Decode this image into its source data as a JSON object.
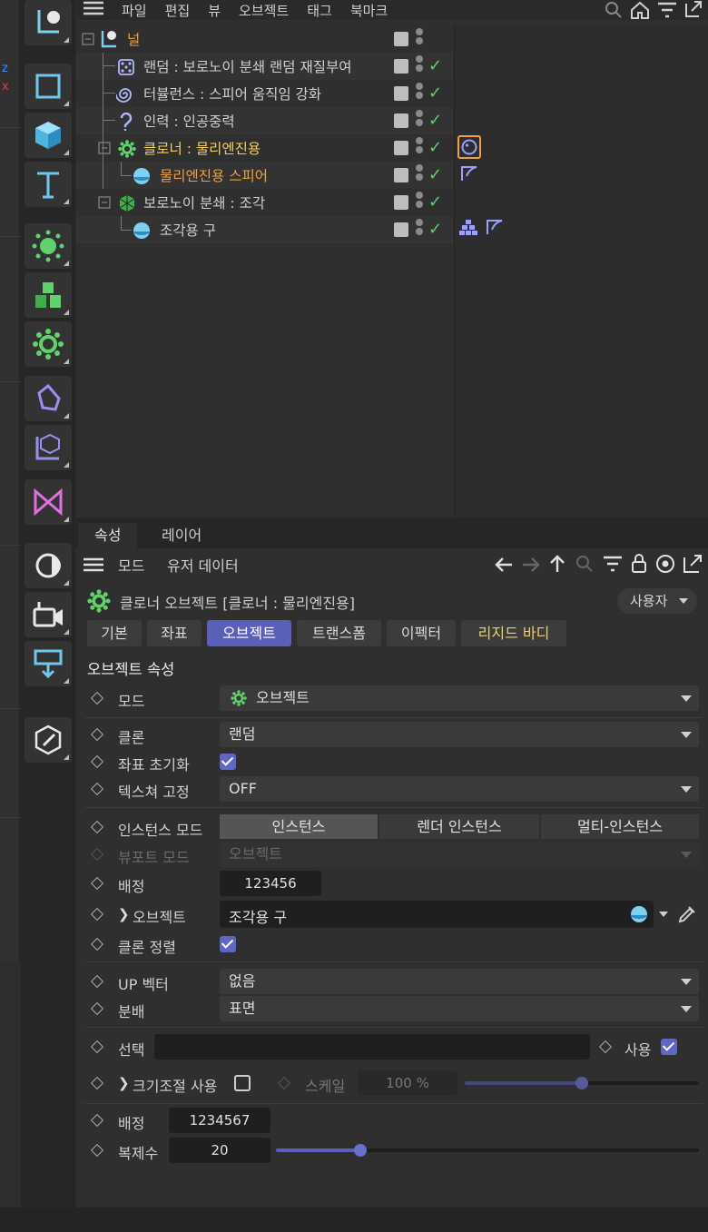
{
  "menu": {
    "items": [
      "파일",
      "편집",
      "뷰",
      "오브젝트",
      "태그",
      "북마크"
    ]
  },
  "objects": [
    {
      "name": "널",
      "color": "orange",
      "indent": 0
    },
    {
      "name": "랜덤 : 보로노이 분쇄 랜덤 재질부여",
      "color": "normal",
      "indent": 1
    },
    {
      "name": "터뷸런스 :  스피어 움직임 강화",
      "color": "normal",
      "indent": 1
    },
    {
      "name": "인력 : 인공중력",
      "color": "normal",
      "indent": 1
    },
    {
      "name": "클로너 : 물리엔진용",
      "color": "yellow",
      "indent": 1
    },
    {
      "name": "물리엔진용 스피어",
      "color": "orange",
      "indent": 2
    },
    {
      "name": "보로노이 분쇄 : 조각",
      "color": "normal",
      "indent": 1
    },
    {
      "name": "조각용 구",
      "color": "normal",
      "indent": 2
    }
  ],
  "attr": {
    "tabs": [
      "속성",
      "레이어"
    ],
    "toolbar": {
      "mode": "모드",
      "userdata": "유저 데이터"
    },
    "title": "클로너 오브젝트 [클로너 : 물리엔진용]",
    "user_button": "사용자",
    "subtabs": [
      "기본",
      "좌표",
      "오브젝트",
      "트랜스폼",
      "이펙터",
      "리지드 바디"
    ],
    "active_subtab": "오브젝트",
    "section_title": "오브젝트 속성",
    "mode": {
      "label": "모드",
      "value": "오브젝트"
    },
    "clone": {
      "label": "클론",
      "value": "랜덤"
    },
    "reset_coords": {
      "label": "좌표 초기화",
      "checked": true
    },
    "fix_texture": {
      "label": "텍스쳐 고정",
      "value": "OFF"
    },
    "instance_mode": {
      "label": "인스턴스 모드",
      "options": [
        "인스턴스",
        "렌더 인스턴스",
        "멀티-인스턴스"
      ],
      "selected": "인스턴스"
    },
    "viewport_mode": {
      "label": "뷰포트 모드",
      "value": "오브젝트"
    },
    "seed": {
      "label": "배정",
      "value": "123456"
    },
    "object": {
      "label": "오브젝트",
      "value": "조각용 구"
    },
    "sort_clones": {
      "label": "클론 정렬",
      "checked": true
    },
    "up_vector": {
      "label": "UP 벡터",
      "value": "없음"
    },
    "distribution": {
      "label": "분배",
      "value": "표면"
    },
    "selection": {
      "label": "선택",
      "value": ""
    },
    "use": {
      "label": "사용",
      "checked": true
    },
    "scale_enable": {
      "label": "크기조절 사용",
      "checked": false
    },
    "scale": {
      "label": "스케일",
      "value": "100 %",
      "fraction": 0.5
    },
    "seed2": {
      "label": "배정",
      "value": "1234567"
    },
    "count": {
      "label": "복제수",
      "value": "20",
      "fraction": 0.2
    }
  },
  "colors": {
    "accent": "#5a5fb8",
    "orange": "#f0a040",
    "yellow": "#f4d15a",
    "check": "#5fd36a"
  }
}
